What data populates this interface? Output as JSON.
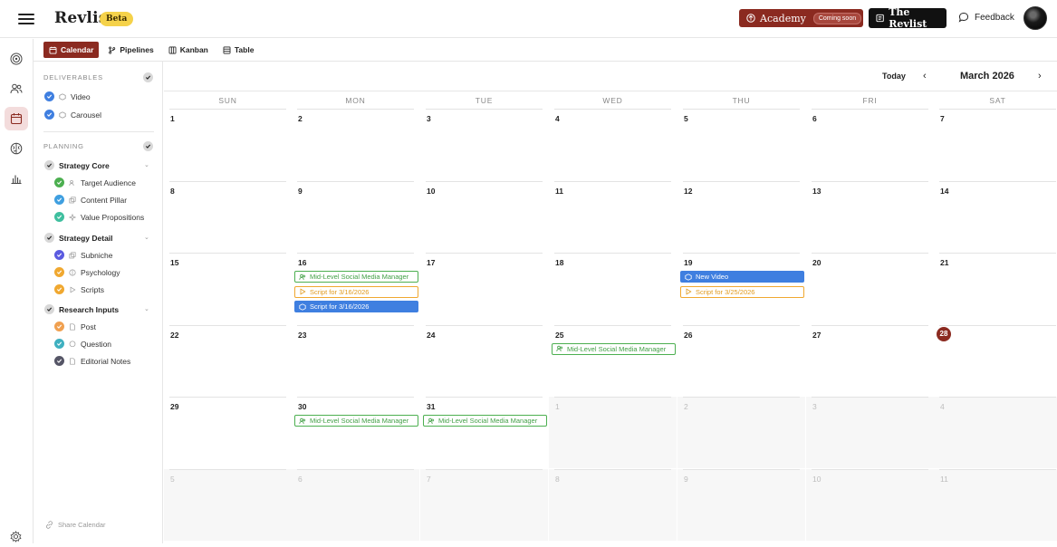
{
  "app": {
    "name": "Revlis",
    "badge": "Beta"
  },
  "header": {
    "academy_label": "Academy",
    "academy_badge": "Coming soon",
    "revlist_label": "The Revlist",
    "feedback_label": "Feedback"
  },
  "tabs": [
    {
      "label": "Calendar",
      "active": true,
      "icon": "calendar-icon"
    },
    {
      "label": "Pipelines",
      "active": false,
      "icon": "pipeline-icon"
    },
    {
      "label": "Kanban",
      "active": false,
      "icon": "kanban-icon"
    },
    {
      "label": "Table",
      "active": false,
      "icon": "table-icon"
    }
  ],
  "rail": [
    "target-icon",
    "users-icon",
    "calendar-icon",
    "brain-icon",
    "bar-chart-icon"
  ],
  "filters": {
    "deliverables_title": "DELIVERABLES",
    "deliverables": [
      {
        "label": "Video",
        "color": "#3f7fe0"
      },
      {
        "label": "Carousel",
        "color": "#3f7fe0"
      }
    ],
    "planning_title": "PLANNING",
    "groups": [
      {
        "label": "Strategy Core",
        "items": [
          {
            "label": "Target Audience",
            "color": "#4caf50"
          },
          {
            "label": "Content Pillar",
            "color": "#3f9fe0"
          },
          {
            "label": "Value Propositions",
            "color": "#3fbf9f"
          }
        ]
      },
      {
        "label": "Strategy Detail",
        "items": [
          {
            "label": "Subniche",
            "color": "#5b5be0"
          },
          {
            "label": "Psychology",
            "color": "#f0a830"
          },
          {
            "label": "Scripts",
            "color": "#f0a830"
          }
        ]
      },
      {
        "label": "Research Inputs",
        "items": [
          {
            "label": "Post",
            "color": "#f0a050"
          },
          {
            "label": "Question",
            "color": "#3fb0c0"
          },
          {
            "label": "Editorial Notes",
            "color": "#555566"
          }
        ]
      }
    ],
    "share_label": "Share Calendar"
  },
  "calendar": {
    "today_label": "Today",
    "month_label": "March 2026",
    "today_day": 28,
    "weekdays": [
      "SUN",
      "MON",
      "TUE",
      "WED",
      "THU",
      "FRI",
      "SAT"
    ],
    "weeks": [
      [
        1,
        2,
        3,
        4,
        5,
        6,
        7
      ],
      [
        8,
        9,
        10,
        11,
        12,
        13,
        14
      ],
      [
        15,
        16,
        17,
        18,
        19,
        20,
        21
      ],
      [
        22,
        23,
        24,
        25,
        26,
        27,
        28
      ],
      [
        29,
        30,
        31,
        1,
        2,
        3,
        4
      ],
      [
        5,
        6,
        7,
        8,
        9,
        10,
        11
      ]
    ],
    "events": [
      {
        "week": 2,
        "day": 1,
        "slot": 0,
        "style": "green",
        "icon": "users-icon",
        "title": "Mid-Level Social Media Manager"
      },
      {
        "week": 2,
        "day": 1,
        "slot": 1,
        "style": "orange",
        "icon": "play-icon",
        "title": "Script for 3/16/2026"
      },
      {
        "week": 2,
        "day": 1,
        "slot": 2,
        "style": "blue",
        "icon": "video-icon",
        "title": "Script for 3/16/2026"
      },
      {
        "week": 2,
        "day": 4,
        "slot": 0,
        "style": "blue",
        "icon": "video-icon",
        "title": "New Video"
      },
      {
        "week": 2,
        "day": 4,
        "slot": 1,
        "style": "orange",
        "icon": "play-icon",
        "title": "Script for 3/25/2026"
      },
      {
        "week": 3,
        "day": 3,
        "slot": 0,
        "style": "green",
        "icon": "users-icon",
        "title": "Mid-Level Social Media Manager"
      },
      {
        "week": 4,
        "day": 1,
        "slot": 0,
        "style": "green",
        "icon": "users-icon",
        "title": "Mid-Level Social Media Manager"
      },
      {
        "week": 4,
        "day": 2,
        "slot": 0,
        "style": "green",
        "icon": "users-icon",
        "title": "Mid-Level Social Media Manager"
      }
    ]
  }
}
